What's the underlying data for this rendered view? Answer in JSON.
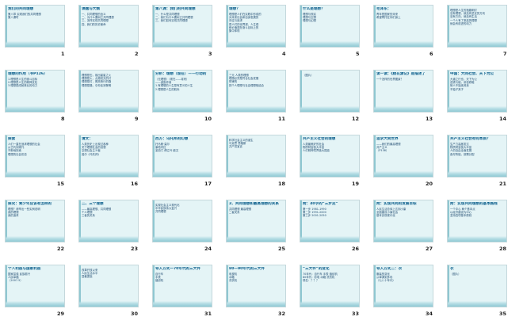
{
  "slides": [
    {
      "n": "1",
      "title": "我们的共同理想",
      "body": [
        "第八章 实现我们的共同理想",
        "第八课时"
      ]
    },
    {
      "n": "2",
      "title": "课题与大纲",
      "body": [
        "一、共同理想的含义",
        "二、为什么要树立共同理想",
        "三、怎样实现共同理想",
        "四、我们的历史使命"
      ]
    },
    {
      "n": "3",
      "title": "第八课：我们的共同理想",
      "body": [
        "一、什么是共同理想",
        "二、我们为什么要树立共同理想",
        "三、我们如何实现共同理想"
      ]
    },
    {
      "n": "4",
      "title": "理想？",
      "body": [
        "理想是人们在实践中形成的",
        "对未来社会和自身发展的",
        "向往与追求",
        "是人们的世界观、人生观",
        "和价值观在奋斗目标上的",
        "集中体现"
      ]
    },
    {
      "n": "5",
      "title": "什么是理想？",
      "body": [
        "理想与现实",
        "理想与空想",
        "理想与幻想"
      ]
    },
    {
      "n": "6",
      "title": "毛泽东：",
      "body": [
        "青年是国家的未来",
        "希望寄托在你们身上"
      ]
    },
    {
      "n": "7",
      "title": "",
      "body": [
        "理想是人生的指路明灯",
        "没有理想，就没有坚定的方向",
        "没有方向，就没有生活",
        "一个人有了崇高的理想",
        "就会有前进的动力"
      ]
    },
    {
      "n": "8",
      "title": "理想的作用（书P126）",
      "body": [
        "1.理想是人生的奋斗目标",
        "2.理想是人生的精神支柱",
        "3.理想是成就事业的动力"
      ]
    },
    {
      "n": "9",
      "title": "",
      "body": [
        "理想是石，敲出星星之火",
        "理想是火，点燃熄灭的灯",
        "理想是灯，照亮夜行的路",
        "理想是路，引你走到黎明"
      ]
    },
    {
      "n": "10",
      "title": "分析：理想（现在）——行动的",
      "body": [
        "（无理想）（现在——将来）",
        "——激励作用",
        "1.有理想的人生是有意义的人生",
        "2.理想是人生的航标"
      ]
    },
    {
      "n": "11",
      "title": "",
      "body": [
        "三元 人类的理想",
        "理想必须是符合社会发展",
        "规律的",
        "把个人理想与社会理想相结合"
      ]
    },
    {
      "n": "12",
      "title": "",
      "body": [
        "（图片）"
      ]
    },
    {
      "n": "13",
      "title": "读一读：《桃花源记》是描述了",
      "body": [
        "一个怎样的世界图景？"
      ]
    },
    {
      "n": "14",
      "title": "中国：大同社会、天下为公",
      "body": [
        "大道之行也，天下为公",
        "选贤与能，讲信修睦",
        "故人不独亲其亲",
        "不独子其子"
      ]
    },
    {
      "n": "15",
      "title": "探索",
      "body": [
        "人们一直在追求理想的社会",
        "从古代到现代",
        "不断地探索",
        "理想的社会形态"
      ]
    },
    {
      "n": "16",
      "title": "请文：",
      "body": [
        "人类历史上出现过各种",
        "关于理想社会的设想",
        "空想社会主义者",
        "莫尔《乌托邦》"
      ]
    },
    {
      "n": "17",
      "title": "西方：乌托邦的幻想",
      "body": [
        "托马斯·莫尔",
        "康帕内拉",
        "圣西门 傅立叶 欧文"
      ]
    },
    {
      "n": "18",
      "title": "",
      "body": [
        "科学社会主义的诞生",
        "马克思 恩格斯",
        "共产党宣言"
      ]
    },
    {
      "n": "19",
      "title": "共产主义社会的理想",
      "body": [
        "人类最美好的社会",
        "物质财富极大丰富",
        "人们精神境界极大提高"
      ]
    },
    {
      "n": "20",
      "title": "追求大同世界",
      "body": [
        "——我们的最高理想",
        "共产主义",
        "（P138）"
      ]
    },
    {
      "n": "21",
      "title": "共产主义社会有何本质？",
      "body": [
        "生产力高度发达",
        "物质财富极大丰富",
        "人的自由全面发展",
        "各尽所能，按需分配"
      ]
    },
    {
      "n": "22",
      "title": "探究：青少年应该有怎样的",
      "body": [
        "理想？请举出一些实例说明",
        "我的理想",
        "我的追求"
      ]
    },
    {
      "n": "23",
      "title": "二、三个理想",
      "body": [
        "——最高理想、共同理想",
        "个人理想",
        "三者的关系"
      ]
    },
    {
      "n": "24",
      "title": "",
      "body": [
        "实现社会主义现代化",
        "中华民族伟大复兴",
        "共同理想"
      ]
    },
    {
      "n": "25",
      "title": "2、共同理想和最高理想的关系",
      "body": [
        "共同理想 最高理想",
        "二者关系"
      ]
    },
    {
      "n": "26",
      "title": "附：40字的“三步走”",
      "body": [
        "第一步 1981-1990",
        "第二步 1991-2000",
        "第三步 2001-2050"
      ]
    },
    {
      "n": "27",
      "title": "附：实现共同的发展目标",
      "body": [
        "人民生活总体上达到小康",
        "全面建设小康社会",
        "基本实现现代化"
      ]
    },
    {
      "n": "28",
      "title": "附：实现共同理想的基本路线",
      "body": [
        "一个中心 两个基本点",
        "以经济建设为中心",
        "坚持四项基本原则"
      ]
    },
    {
      "n": "29",
      "title": "个人利益与国家利益",
      "body": [
        "国家富强 民族振兴",
        "人民幸福",
        "（2007.5）"
      ]
    },
    {
      "n": "30",
      "title": "",
      "body": [
        "改革开放以来",
        "人民生活水平",
        "显著提高"
      ]
    },
    {
      "n": "31",
      "title": "导入方式一70年代的三大件",
      "body": [
        "自行车",
        "手表",
        "缝纫机"
      ]
    },
    {
      "n": "32",
      "title": "80—90年代的三大件",
      "body": [
        "电视机",
        "冰箱",
        "洗衣机"
      ]
    },
    {
      "n": "33",
      "title": "“三大件”的变化",
      "body": [
        "70年代：自行车 手表 缝纫机",
        "80年代：彩电 冰箱 洗衣机",
        "现在：？？？"
      ]
    },
    {
      "n": "34",
      "title": "导入方式二：衣",
      "body": [
        "服装的变化",
        "从单调到多彩",
        "（七八十年代）"
      ]
    },
    {
      "n": "35",
      "title": "衣",
      "body": [
        "（图片）"
      ]
    }
  ]
}
